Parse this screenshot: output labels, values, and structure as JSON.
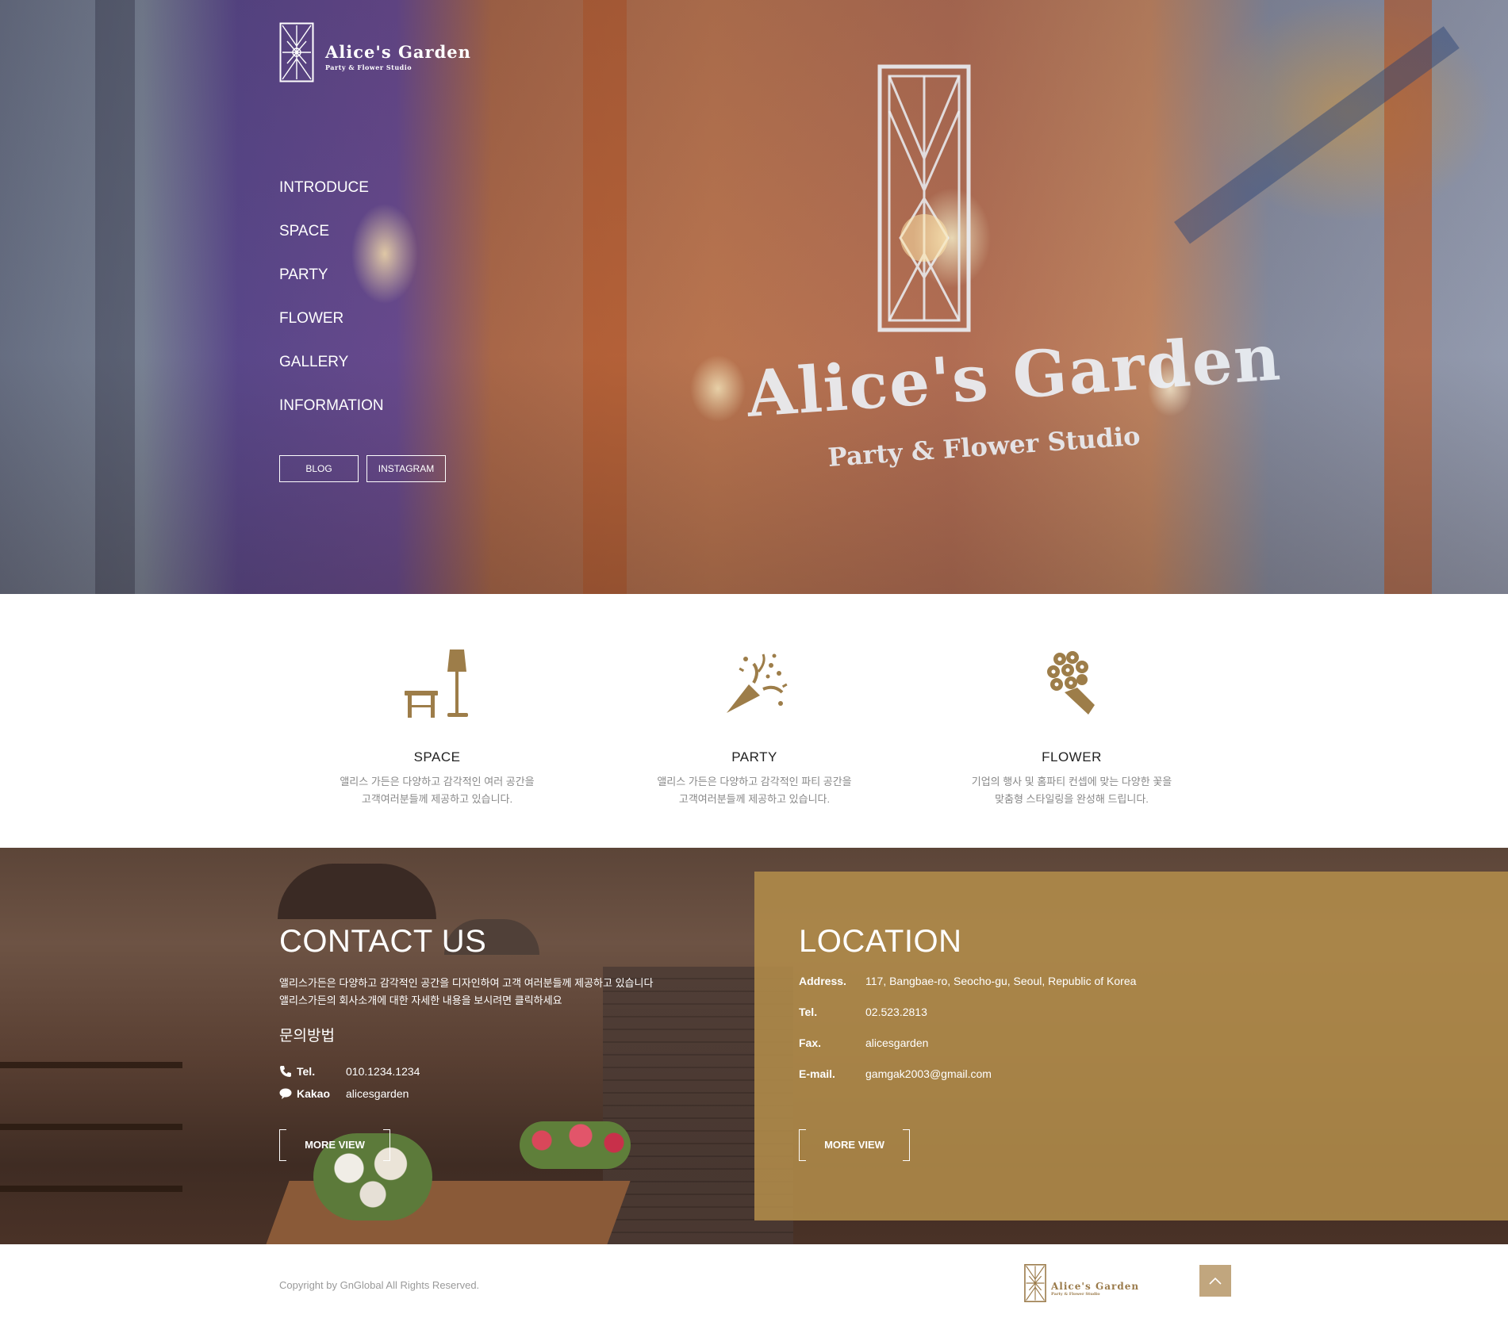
{
  "brand": {
    "name": "Alice's Garden",
    "tagline": "Party & Flower Studio",
    "color_gold": "#b28c4a",
    "color_icon": "#9d7d49"
  },
  "hero": {
    "nav": [
      "INTRODUCE",
      "SPACE",
      "PARTY",
      "FLOWER",
      "GALLERY",
      "INFORMATION"
    ],
    "buttons": {
      "blog": "BLOG",
      "instagram": "INSTAGRAM"
    },
    "glass_title": "Alice's Garden",
    "glass_subtitle": "Party & Flower Studio"
  },
  "services": [
    {
      "icon": "chair-lamp-icon",
      "title": "SPACE",
      "line1": "앨리스 가든은 다양하고 감각적인 여러 공간을",
      "line2": "고객여러분들께 제공하고 있습니다."
    },
    {
      "icon": "party-popper-icon",
      "title": "PARTY",
      "line1": "앨리스 가든은 다양하고 감각적인 파티 공간을",
      "line2": "고객여러분들께 제공하고 있습니다."
    },
    {
      "icon": "bouquet-icon",
      "title": "FLOWER",
      "line1": "기업의 행사 및 홈파티 컨셉에 맞는 다양한 꽃을",
      "line2": "맞춤형 스타일링을 완성해 드립니다."
    }
  ],
  "contact": {
    "title": "CONTACT US",
    "desc1": "앨리스가든은 다양하고 감각적인 공간을 디자인하여 고객 여러분들께 제공하고 있습니다",
    "desc2": "앨리스가든의 회사소개에 대한 자세한 내용을 보시려면 클릭하세요",
    "subtitle": "문의방법",
    "tel_label": "Tel.",
    "tel_value": "010.1234.1234",
    "kakao_label": "Kakao",
    "kakao_value": "alicesgarden",
    "more": "MORE VIEW"
  },
  "location": {
    "title": "LOCATION",
    "rows": [
      {
        "label": "Address.",
        "value": "117, Bangbae-ro, Seocho-gu, Seoul, Republic of Korea"
      },
      {
        "label": "Tel.",
        "value": "02.523.2813"
      },
      {
        "label": "Fax.",
        "value": "alicesgarden"
      },
      {
        "label": "E-mail.",
        "value": "gamgak2003@gmail.com"
      }
    ],
    "more": "MORE VIEW"
  },
  "footer": {
    "copyright": "Copyright by GnGlobal All Rights Reserved.",
    "logo_name": "Alice's Garden",
    "logo_tagline": "Party & Flower Studio"
  }
}
